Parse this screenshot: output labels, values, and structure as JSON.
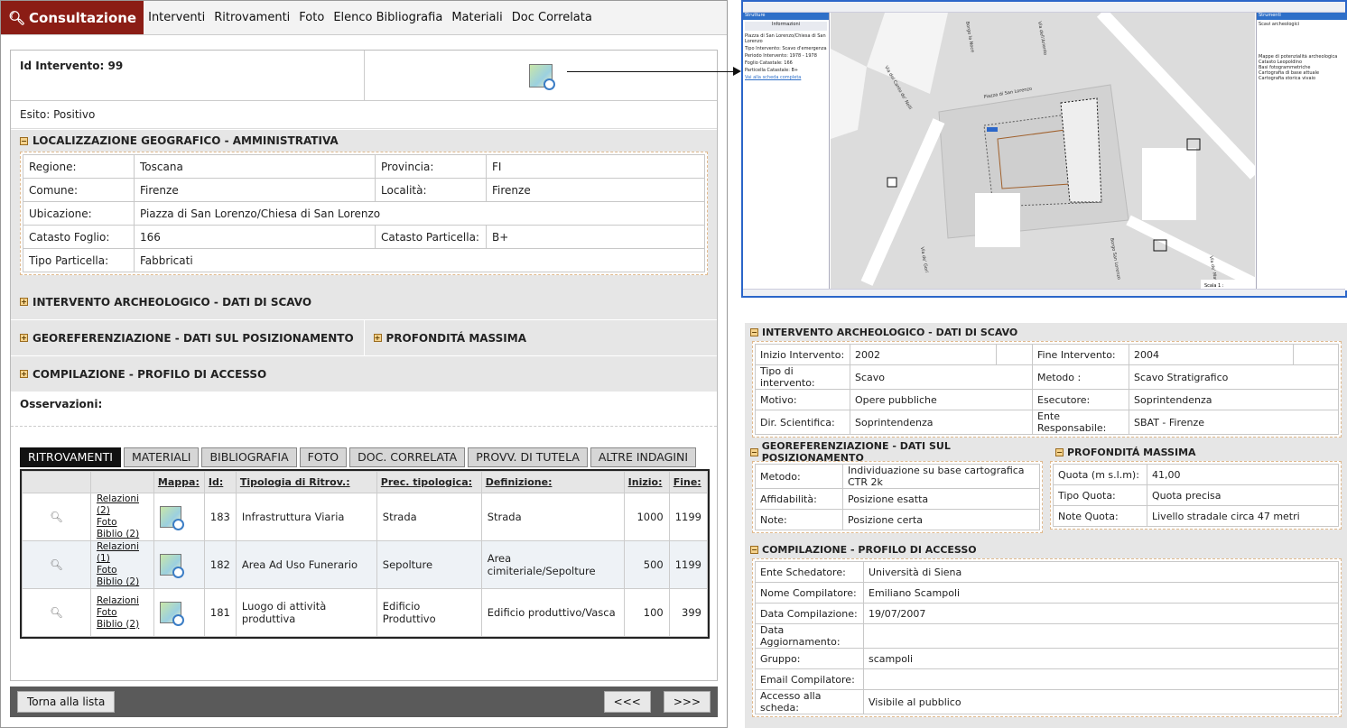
{
  "menu": {
    "active": "Consultazione",
    "items": [
      "Interventi",
      "Ritrovamenti",
      "Foto",
      "Elenco Bibliografia",
      "Materiali",
      "Doc Correlata"
    ]
  },
  "detail": {
    "id_label": "Id Intervento: 99",
    "esito_label": "Esito:",
    "esito_value": "Positivo",
    "loc_title": "LOCALIZZAZIONE GEOGRAFICO - AMMINISTRATIVA",
    "loc": {
      "regione_l": "Regione:",
      "regione": "Toscana",
      "provincia_l": "Provincia:",
      "provincia": "FI",
      "comune_l": "Comune:",
      "comune": "Firenze",
      "localita_l": "Località:",
      "localita": "Firenze",
      "ubicazione_l": "Ubicazione:",
      "ubicazione": "Piazza di San Lorenzo/Chiesa di San Lorenzo",
      "foglio_l": "Catasto Foglio:",
      "foglio": "166",
      "particella_l": "Catasto Particella:",
      "particella": "B+",
      "tipo_l": "Tipo Particella:",
      "tipo": "Fabbricati"
    },
    "sec_scavo": "INTERVENTO ARCHEOLOGICO - DATI DI SCAVO",
    "sec_geo": "GEOREFERENZIAZIONE - DATI SUL POSIZIONAMENTO",
    "sec_prof": "PROFONDITÁ MASSIMA",
    "sec_comp": "COMPILAZIONE - PROFILO DI ACCESSO",
    "oss": "Osservazioni:"
  },
  "tabs": [
    "RITROVAMENTI",
    "MATERIALI",
    "BIBLIOGRAFIA",
    "FOTO",
    "DOC. CORRELATA",
    "PROVV. DI TUTELA",
    "ALTRE INDAGINI"
  ],
  "results": {
    "headers": [
      "",
      "",
      "Mappa:",
      "Id:",
      "Tipologia di Ritrov.:",
      "Prec. tipologica:",
      "Definizione:",
      "Inizio:",
      "Fine:"
    ],
    "rows": [
      {
        "l1": "Relazioni (2)",
        "l2": "Foto",
        "l3": "Biblio (2)",
        "id": "183",
        "tip": "Infrastruttura Viaria",
        "prec": "Strada",
        "def": "Strada",
        "inizio": "1000",
        "fine": "1199"
      },
      {
        "l1": "Relazioni (1)",
        "l2": "Foto",
        "l3": "Biblio (2)",
        "id": "182",
        "tip": "Area Ad Uso Funerario",
        "prec": "Sepolture",
        "def": "Area cimiteriale/Sepolture",
        "inizio": "500",
        "fine": "1199"
      },
      {
        "l1": "Relazioni",
        "l2": "Foto",
        "l3": "Biblio (2)",
        "id": "181",
        "tip": "Luogo di attività produttiva",
        "prec": "Edificio Produttivo",
        "def": "Edificio produttivo/Vasca",
        "inizio": "100",
        "fine": "399"
      }
    ]
  },
  "buttons": {
    "back": "Torna alla lista",
    "prev": "<<<",
    "next": ">>>"
  },
  "mapwin": {
    "left_title": "Strutture",
    "info_tab": "Informazioni",
    "info": [
      "Piazza di San Lorenzo/Chiesa di San Lorenzo",
      "Tipo Intervento: Scavo d'emergenza",
      "Periodo Intervento: 1978 - 1978",
      "Foglio Catastale: 166",
      "Particella Catastale: B+",
      "Vai alla scheda completa"
    ],
    "right_title": "Strumenti",
    "layers": [
      "Scavi archeologici",
      "Mappe di potenzialità archeologica",
      "Catasto Leopoldino",
      "Basi fotogrammetriche",
      "Cartografia di base attuale",
      "Cartografia storica vivaio"
    ],
    "streets": [
      "Via del Canto de' Nelli",
      "Piazza di San Lorenzo",
      "Borgo la Noce",
      "Via dell'Ariento",
      "Borgo San Lorenzo",
      "Via de' Gori",
      "Via de' Martelli"
    ],
    "scale": "Scala 1 :"
  },
  "scavo": {
    "title": "INTERVENTO ARCHEOLOGICO - DATI DI SCAVO",
    "r": [
      [
        "Inizio Intervento:",
        "2002",
        "Fine Intervento:",
        "2004"
      ],
      [
        "Tipo di intervento:",
        "Scavo",
        "Metodo :",
        "Scavo Stratigrafico"
      ],
      [
        "Motivo:",
        "Opere pubbliche",
        "Esecutore:",
        "Soprintendenza"
      ],
      [
        "Dir. Scientifica:",
        "Soprintendenza",
        "Ente Responsabile:",
        "SBAT - Firenze"
      ]
    ]
  },
  "geo": {
    "title": "GEOREFERENZIAZIONE - DATI SUL POSIZIONAMENTO",
    "r": [
      [
        "Metodo:",
        "Individuazione su base cartografica CTR 2k"
      ],
      [
        "Affidabilità:",
        "Posizione esatta"
      ],
      [
        "Note:",
        "Posizione certa"
      ]
    ]
  },
  "prof": {
    "title": "PROFONDITÁ MASSIMA",
    "r": [
      [
        "Quota (m s.l.m):",
        "41,00"
      ],
      [
        "Tipo Quota:",
        "Quota precisa"
      ],
      [
        "Note Quota:",
        "Livello stradale circa 47 metri"
      ]
    ]
  },
  "comp": {
    "title": "COMPILAZIONE - PROFILO DI ACCESSO",
    "r": [
      [
        "Ente Schedatore:",
        "Università di Siena"
      ],
      [
        "Nome Compilatore:",
        "Emiliano Scampoli"
      ],
      [
        "Data Compilazione:",
        "19/07/2007"
      ],
      [
        "Data Aggiornamento:",
        ""
      ],
      [
        "Gruppo:",
        "scampoli"
      ],
      [
        "Email Compilatore:",
        ""
      ],
      [
        "Accesso alla scheda:",
        "Visibile al pubblico"
      ]
    ]
  }
}
